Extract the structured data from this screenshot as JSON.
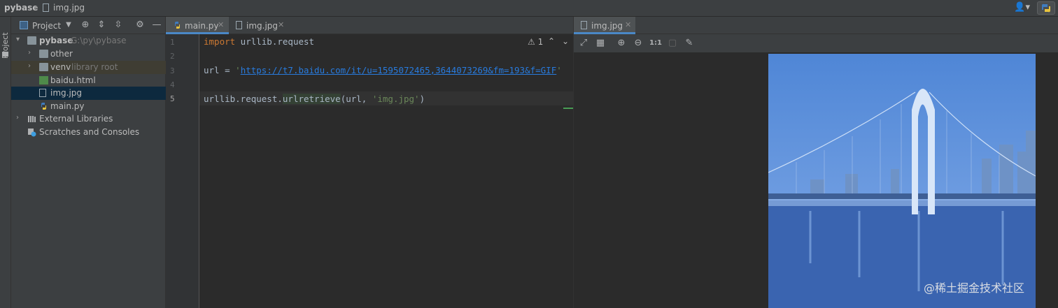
{
  "breadcrumb": {
    "project": "pybase",
    "file": "img.jpg"
  },
  "left_strip": {
    "label": "Project"
  },
  "project_panel": {
    "header_label": "Project",
    "tree": [
      {
        "label": "pybase",
        "hint": "G:\\py\\pybase",
        "type": "folder",
        "depth": 0,
        "expanded": true
      },
      {
        "label": "other",
        "type": "folder",
        "depth": 1
      },
      {
        "label": "venv",
        "hint": "library root",
        "type": "folder",
        "depth": 1
      },
      {
        "label": "baidu.html",
        "type": "html",
        "depth": 1
      },
      {
        "label": "img.jpg",
        "type": "image",
        "depth": 1,
        "selected": true
      },
      {
        "label": "main.py",
        "type": "python",
        "depth": 1
      },
      {
        "label": "External Libraries",
        "type": "library",
        "depth": 0
      },
      {
        "label": "Scratches and Consoles",
        "type": "scratch",
        "depth": 0
      }
    ]
  },
  "editor": {
    "tabs": [
      {
        "label": "main.py",
        "active": true
      },
      {
        "label": "img.jpg",
        "active": false
      }
    ],
    "line_numbers": [
      "1",
      "2",
      "3",
      "4",
      "5"
    ],
    "warning_count": "1",
    "code": {
      "l1_kw": "import",
      "l1_rest": " urllib.request",
      "l3_a": "url = ",
      "l3_q1": "'",
      "l3_url": "https://t7.baidu.com/it/u=1595072465,3644073269&fm=193&f=GIF",
      "l3_q2": "'",
      "l5_a": "urllib.request.",
      "l5_call": "urlretrieve",
      "l5_b": "(url, ",
      "l5_str": "'img.jpg'",
      "l5_c": ")"
    }
  },
  "image_viewer": {
    "tab_label": "img.jpg",
    "tools": [
      "zoom-fit-icon",
      "grid-icon",
      "zoom-in-icon",
      "zoom-out-icon",
      "actual-size-icon",
      "background-icon",
      "color-picker-icon"
    ],
    "actual_size_label": "1:1",
    "watermark": "@稀土掘金技术社区"
  },
  "colors": {
    "accent": "#4a88c7",
    "selection": "#0d293e",
    "keyword": "#cc7832",
    "string": "#6a8759"
  }
}
